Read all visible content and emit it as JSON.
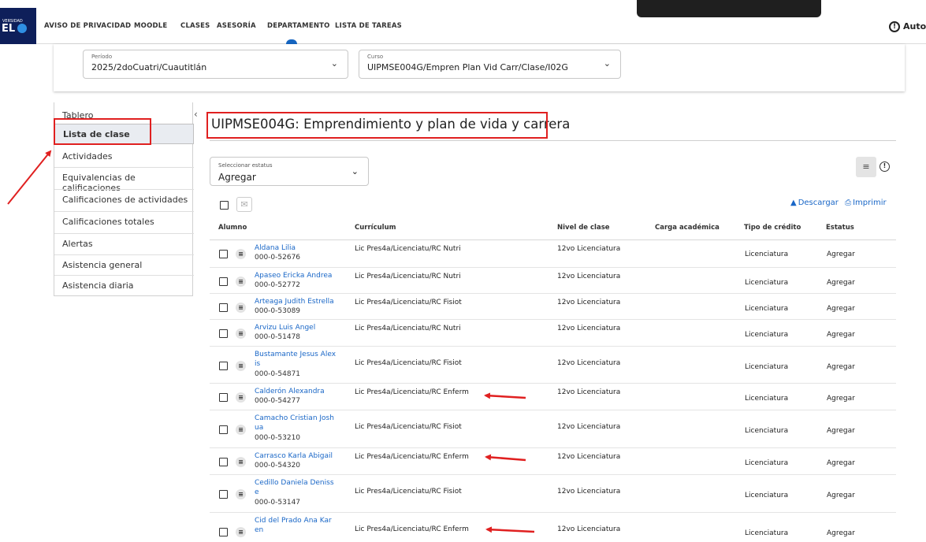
{
  "nav": {
    "logo_line1": "VERSIDAD",
    "logo_line2": "EL",
    "items": [
      "AVISO DE PRIVACIDAD",
      "MOODLE",
      "CLASES",
      "ASESORÍA",
      "DEPARTAMENTO",
      "LISTA DE TAREAS"
    ],
    "user_label": "Autor"
  },
  "filters": {
    "period": {
      "caption": "Período",
      "value": "2025/2doCuatri/Cuautitlán"
    },
    "course": {
      "caption": "Curso",
      "value": "UIPMSE004G/Empren Plan Vid Carr/Clase/I02G"
    }
  },
  "sidebar": {
    "items": [
      "Tablero",
      "Lista de clase",
      "Actividades",
      "Equivalencias de calificaciones",
      "Calificaciones de actividades",
      "Calificaciones totales",
      "Alertas",
      "Asistencia general",
      "Asistencia diaria"
    ],
    "active_index": 1
  },
  "main": {
    "title": "UIPMSE004G: Emprendimiento y plan de vida y carrera",
    "status_select": {
      "caption": "Seleccionar estatus",
      "value": "Agregar"
    },
    "download_label": "Descargar",
    "print_label": "Imprimir"
  },
  "table": {
    "headers": {
      "alumno": "Alumno",
      "curriculum": "Currículum",
      "nivel": "Nivel de clase",
      "carga": "Carga académica",
      "tipo": "Tipo de crédito",
      "estatus": "Estatus"
    },
    "rows": [
      {
        "name": "Aldana Lilia",
        "id": "000-0-52676",
        "curriculum": "Lic Pres4a/Licenciatu/RC Nutri",
        "nivel": "12vo Licenciatura",
        "tipo": "Licenciatura",
        "estatus": "Agregar"
      },
      {
        "name": "Apaseo Ericka Andrea",
        "id": "000-0-52772",
        "curriculum": "Lic Pres4a/Licenciatu/RC Nutri",
        "nivel": "12vo Licenciatura",
        "tipo": "Licenciatura",
        "estatus": "Agregar"
      },
      {
        "name": "Arteaga Judith Estrella",
        "id": "000-0-53089",
        "curriculum": "Lic Pres4a/Licenciatu/RC Fisiot",
        "nivel": "12vo Licenciatura",
        "tipo": "Licenciatura",
        "estatus": "Agregar"
      },
      {
        "name": "Arvizu Luis Angel",
        "id": "000-0-51478",
        "curriculum": "Lic Pres4a/Licenciatu/RC Nutri",
        "nivel": "12vo Licenciatura",
        "tipo": "Licenciatura",
        "estatus": "Agregar"
      },
      {
        "name": "Bustamante Jesus Alex is",
        "id": "000-0-54871",
        "curriculum": "Lic Pres4a/Licenciatu/RC Fisiot",
        "nivel": "12vo Licenciatura",
        "tipo": "Licenciatura",
        "estatus": "Agregar"
      },
      {
        "name": "Calderón Alexandra",
        "id": "000-0-54277",
        "curriculum": "Lic Pres4a/Licenciatu/RC Enferm",
        "nivel": "12vo Licenciatura",
        "tipo": "Licenciatura",
        "estatus": "Agregar"
      },
      {
        "name": "Camacho Cristian Josh ua",
        "id": "000-0-53210",
        "curriculum": "Lic Pres4a/Licenciatu/RC Fisiot",
        "nivel": "12vo Licenciatura",
        "tipo": "Licenciatura",
        "estatus": "Agregar"
      },
      {
        "name": "Carrasco Karla Abigail",
        "id": "000-0-54320",
        "curriculum": "Lic Pres4a/Licenciatu/RC Enferm",
        "nivel": "12vo Licenciatura",
        "tipo": "Licenciatura",
        "estatus": "Agregar"
      },
      {
        "name": "Cedillo Daniela Deniss e",
        "id": "000-0-53147",
        "curriculum": "Lic Pres4a/Licenciatu/RC Fisiot",
        "nivel": "12vo Licenciatura",
        "tipo": "Licenciatura",
        "estatus": "Agregar"
      },
      {
        "name": "Cid del Prado Ana Kar en",
        "id": "",
        "curriculum": "Lic Pres4a/Licenciatu/RC Enferm",
        "nivel": "12vo Licenciatura",
        "tipo": "Licenciatura",
        "estatus": "Agregar"
      }
    ]
  },
  "colors": {
    "annotation": "#e02020",
    "link": "#1a67c7",
    "nav_accent": "#1565c0"
  }
}
